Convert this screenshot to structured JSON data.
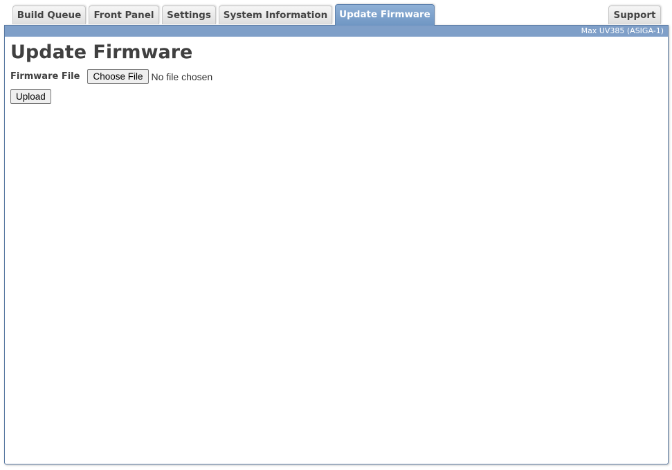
{
  "tabs": {
    "build_queue": "Build Queue",
    "front_panel": "Front Panel",
    "settings": "Settings",
    "system_information": "System Information",
    "update_firmware": "Update Firmware",
    "support": "Support",
    "active": "Update Firmware"
  },
  "header": {
    "device_name": "Max UV385 (ASIGA-1)"
  },
  "page": {
    "title": "Update Firmware",
    "firmware_file_label": "Firmware File",
    "choose_file_label": "Choose File",
    "file_status": "No file chosen",
    "upload_label": "Upload"
  },
  "colors": {
    "accent": "#7f9fc8",
    "active_tab": "#7a9dc9",
    "text": "#404040"
  }
}
